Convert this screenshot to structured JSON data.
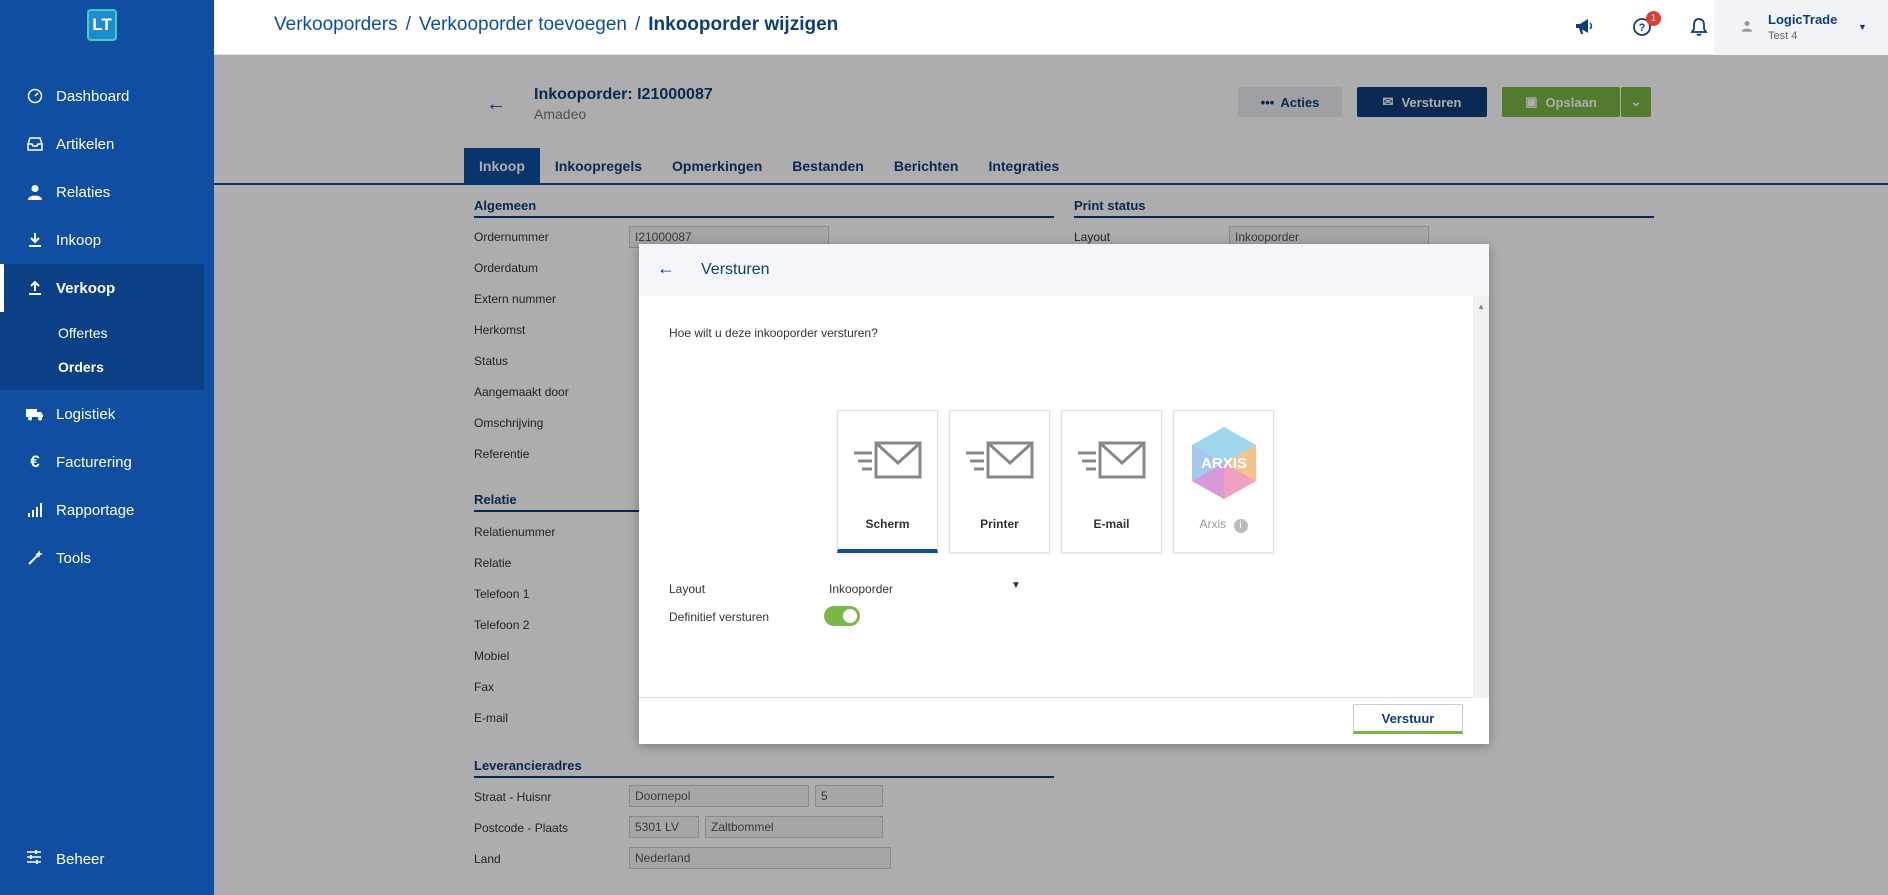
{
  "app": {
    "logo_text": "LT"
  },
  "sidebar": {
    "items": [
      {
        "label": "Dashboard",
        "icon": "dashboard-icon"
      },
      {
        "label": "Artikelen",
        "icon": "inbox-icon"
      },
      {
        "label": "Relaties",
        "icon": "user-icon"
      },
      {
        "label": "Inkoop",
        "icon": "download-icon"
      },
      {
        "label": "Verkoop",
        "icon": "upload-icon"
      },
      {
        "label": "Logistiek",
        "icon": "truck-icon"
      },
      {
        "label": "Facturering",
        "icon": "euro-icon"
      },
      {
        "label": "Rapportage",
        "icon": "signal-icon"
      },
      {
        "label": "Tools",
        "icon": "wand-icon"
      }
    ],
    "submenu": [
      {
        "label": "Offertes"
      },
      {
        "label": "Orders"
      }
    ],
    "footer": {
      "label": "Beheer",
      "icon": "sliders-icon"
    }
  },
  "topbar": {
    "breadcrumb": [
      "Verkooporders",
      "Verkooporder toevoegen",
      "Inkooporder wijzigen"
    ],
    "separator": "/",
    "notification_count": "1",
    "user_name": "LogicTrade",
    "user_sub": "Test 4"
  },
  "page": {
    "title": "Inkooporder: I21000087",
    "subtitle": "Amadeo",
    "btn_acties": "Acties",
    "btn_versturen": "Versturen",
    "btn_opslaan": "Opslaan",
    "tabs": [
      "Inkoop",
      "Inkoopregels",
      "Opmerkingen",
      "Bestanden",
      "Berichten",
      "Integraties"
    ],
    "section_algemeen": "Algemeen",
    "section_print": "Print status",
    "print_layout_label": "Layout",
    "print_layout_value": "Inkooporder",
    "algemeen_fields": [
      "Ordernummer",
      "Orderdatum",
      "Extern nummer",
      "Herkomst",
      "Status",
      "Aangemaakt door",
      "Omschrijving",
      "Referentie"
    ],
    "ordernummer_value": "I21000087",
    "section_relatie": "Relatie",
    "relatie_fields": [
      "Relatienummer",
      "Relatie",
      "Telefoon 1",
      "Telefoon 2",
      "Mobiel",
      "Fax",
      "E-mail"
    ],
    "section_leverancier": "Leverancieradres",
    "leverancier_fields": [
      "Straat - Huisnr",
      "Postcode - Plaats",
      "Land"
    ],
    "straat": "Doornepol",
    "huisnr": "5",
    "postcode": "5301 LV",
    "plaats": "Zaltbommel",
    "land": "Nederland"
  },
  "modal": {
    "title": "Versturen",
    "question": "Hoe wilt u deze inkooporder versturen?",
    "options": [
      {
        "label": "Scherm",
        "icon": "envelope-icon"
      },
      {
        "label": "Printer",
        "icon": "envelope-icon"
      },
      {
        "label": "E-mail",
        "icon": "envelope-icon"
      },
      {
        "label": "Arxis",
        "icon": "arxis-logo-icon"
      }
    ],
    "arxis_logo_text": "ARXIS",
    "layout_label": "Layout",
    "layout_value": "Inkooporder",
    "definitief_label": "Definitief versturen",
    "definitief_on": true,
    "submit_label": "Verstuur"
  },
  "colors": {
    "primary": "#0f4ea0",
    "dark": "#0f3d7a",
    "accent": "#7ab648",
    "badge": "#e53935"
  }
}
